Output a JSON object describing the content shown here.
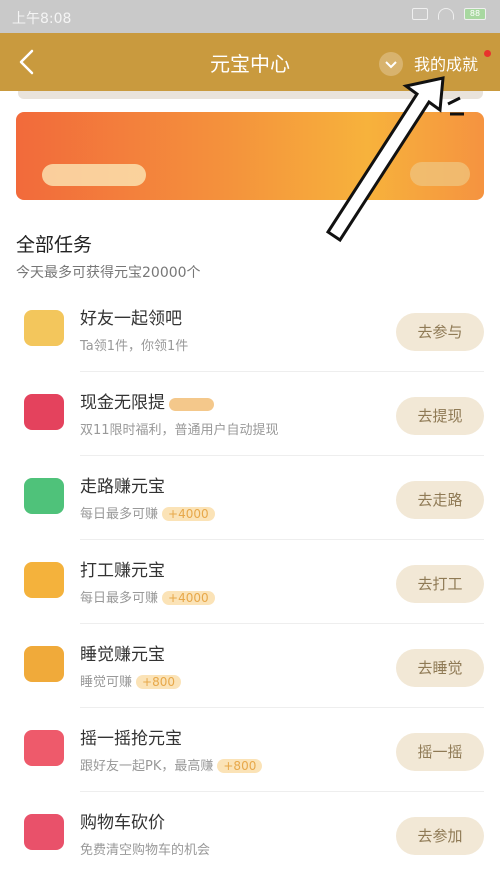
{
  "status_bar": {
    "time": "上午8:08",
    "battery": "88"
  },
  "header": {
    "title": "元宝中心",
    "achievements": "我的成就"
  },
  "section": {
    "title": "全部任务",
    "subtitle": "今天最多可获得元宝20000个"
  },
  "tasks": [
    {
      "name": "好友一起领吧",
      "desc": "Ta领1件，你领1件",
      "button": "去参与",
      "color": "#f3c65c"
    },
    {
      "name": "现金无限提",
      "desc": "双11限时福利，普通用户自动提现",
      "button": "去提现",
      "color": "#e4425d"
    },
    {
      "name": "走路赚元宝",
      "desc": "每日最多可赚",
      "badge": "+4000",
      "button": "去走路",
      "color": "#4fc27a"
    },
    {
      "name": "打工赚元宝",
      "desc": "每日最多可赚",
      "badge": "+4000",
      "button": "去打工",
      "color": "#f4b23c"
    },
    {
      "name": "睡觉赚元宝",
      "desc": "睡觉可赚",
      "badge": "+800",
      "button": "去睡觉",
      "color": "#f0aa3a"
    },
    {
      "name": "摇一摇抢元宝",
      "desc": "跟好友一起PK，最高赚",
      "badge": "+800",
      "button": "摇一摇",
      "color": "#ee5a6b"
    },
    {
      "name": "购物车砍价",
      "desc": "免费清空购物车的机会",
      "button": "去参加",
      "color": "#e9516a"
    }
  ]
}
